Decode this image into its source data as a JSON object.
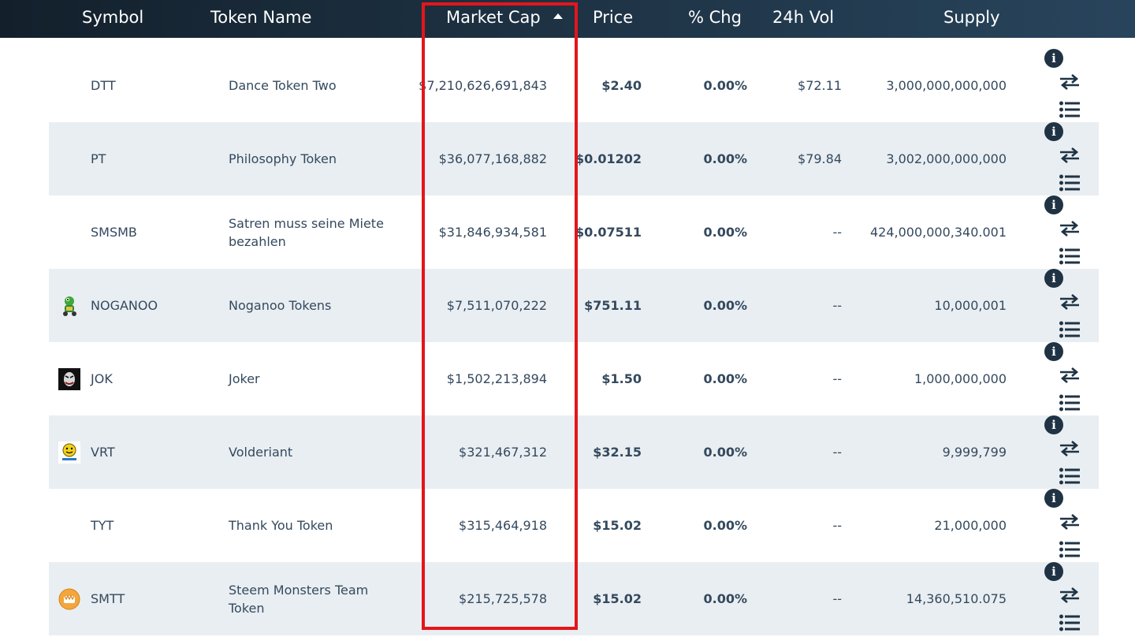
{
  "header": {
    "symbol": "Symbol",
    "token_name": "Token Name",
    "market_cap": "Market Cap",
    "price": "Price",
    "pct_chg": "% Chg",
    "vol_24h": "24h Vol",
    "supply": "Supply",
    "sort_icon": "caret-up-icon"
  },
  "rows": [
    {
      "symbol": "DTT",
      "name": "Dance Token Two",
      "market_cap": "$7,210,626,691,843",
      "price": "$2.40",
      "pct_chg": "0.00%",
      "vol": "$72.11",
      "supply": "3,000,000,000,000",
      "logo": "none"
    },
    {
      "symbol": "PT",
      "name": "Philosophy Token",
      "market_cap": "$36,077,168,882",
      "price": "$0.01202",
      "pct_chg": "0.00%",
      "vol": "$79.84",
      "supply": "3,002,000,000,000",
      "logo": "none"
    },
    {
      "symbol": "SMSMB",
      "name": "Satren muss seine Miete bezahlen",
      "market_cap": "$31,846,934,581",
      "price": "$0.07511",
      "pct_chg": "0.00%",
      "vol": "--",
      "supply": "424,000,000,340.001",
      "logo": "none"
    },
    {
      "symbol": "NOGANOO",
      "name": "Noganoo Tokens",
      "market_cap": "$7,511,070,222",
      "price": "$751.11",
      "pct_chg": "0.00%",
      "vol": "--",
      "supply": "10,000,001",
      "logo": "frog-logo-icon"
    },
    {
      "symbol": "JOK",
      "name": "Joker",
      "market_cap": "$1,502,213,894",
      "price": "$1.50",
      "pct_chg": "0.00%",
      "vol": "--",
      "supply": "1,000,000,000",
      "logo": "joker-logo-icon"
    },
    {
      "symbol": "VRT",
      "name": "Volderiant",
      "market_cap": "$321,467,312",
      "price": "$32.15",
      "pct_chg": "0.00%",
      "vol": "--",
      "supply": "9,999,799",
      "logo": "smiley-logo-icon"
    },
    {
      "symbol": "TYT",
      "name": "Thank You Token",
      "market_cap": "$315,464,918",
      "price": "$15.02",
      "pct_chg": "0.00%",
      "vol": "--",
      "supply": "21,000,000",
      "logo": "none"
    },
    {
      "symbol": "SMTT",
      "name": "Steem Monsters Team Token",
      "market_cap": "$215,725,578",
      "price": "$15.02",
      "pct_chg": "0.00%",
      "vol": "--",
      "supply": "14,360,510.075",
      "logo": "monster-logo-icon"
    }
  ],
  "colors": {
    "header_bg": "#1d3142",
    "row_alt": "#e9eef2",
    "text": "#34495e",
    "icon": "#1f3344",
    "highlight": "#e3161b"
  }
}
